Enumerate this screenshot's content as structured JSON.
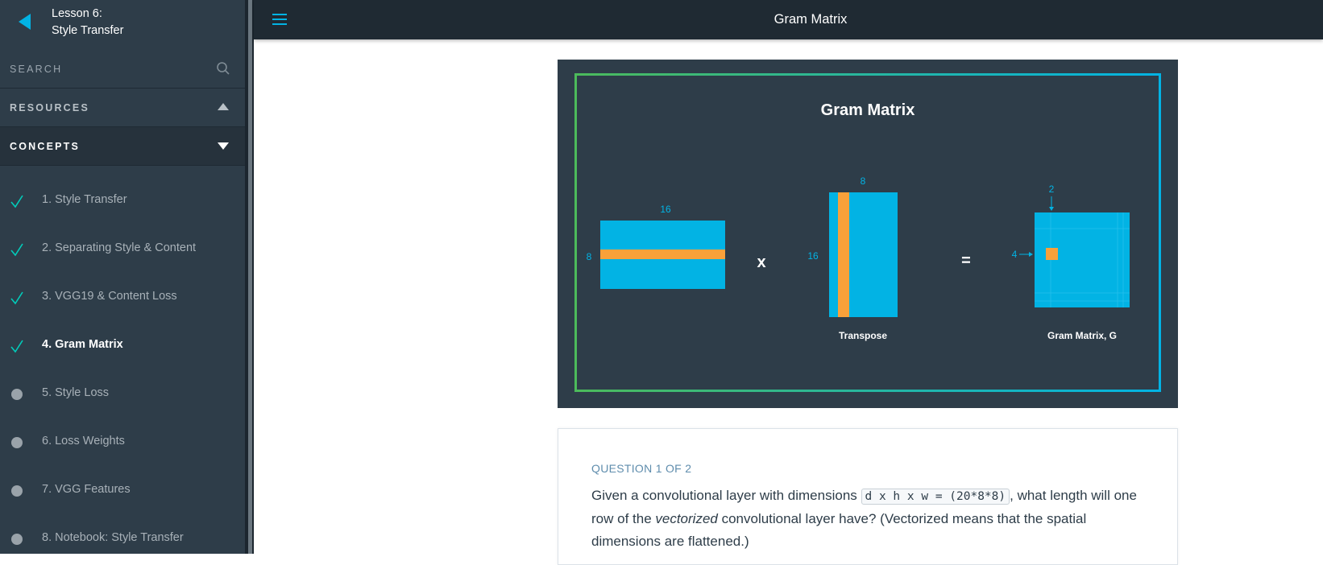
{
  "lesson": {
    "line1": "Lesson 6:",
    "line2": "Style Transfer"
  },
  "sidebar": {
    "search_label": "SEARCH",
    "resources_label": "RESOURCES",
    "concepts_label": "CONCEPTS",
    "items": [
      {
        "label": "1. Style Transfer",
        "status": "complete"
      },
      {
        "label": "2. Separating Style & Content",
        "status": "complete"
      },
      {
        "label": "3. VGG19 & Content Loss",
        "status": "complete"
      },
      {
        "label": "4. Gram Matrix",
        "status": "complete",
        "active": true
      },
      {
        "label": "5. Style Loss",
        "status": "incomplete"
      },
      {
        "label": "6. Loss Weights",
        "status": "incomplete"
      },
      {
        "label": "7. VGG Features",
        "status": "incomplete"
      },
      {
        "label": "8. Notebook: Style Transfer",
        "status": "incomplete"
      }
    ]
  },
  "header": {
    "title": "Gram Matrix"
  },
  "figure": {
    "title": "Gram Matrix",
    "m1_width_label": "16",
    "m1_height_label": "8",
    "times": "x",
    "m2_width_label": "8",
    "m2_height_label": "16",
    "m2_caption": "Transpose",
    "equals": "=",
    "g_col_label": "2",
    "g_row_label": "4",
    "g_caption": "Gram Matrix, G"
  },
  "question": {
    "label": "QUESTION 1 OF 2",
    "text_before": "Given a convolutional layer with dimensions ",
    "code": "d x h x w = (20*8*8)",
    "text_mid": ", what length will one row of the ",
    "emphasis": "vectorized",
    "text_after": " convolutional layer have? (Vectorized means that the spatial dimensions are flattened.)"
  },
  "colors": {
    "accent": "#02b3e4",
    "orange": "#f9a13a",
    "complete": "#02ccba",
    "sidebar": "#2e3d49"
  }
}
